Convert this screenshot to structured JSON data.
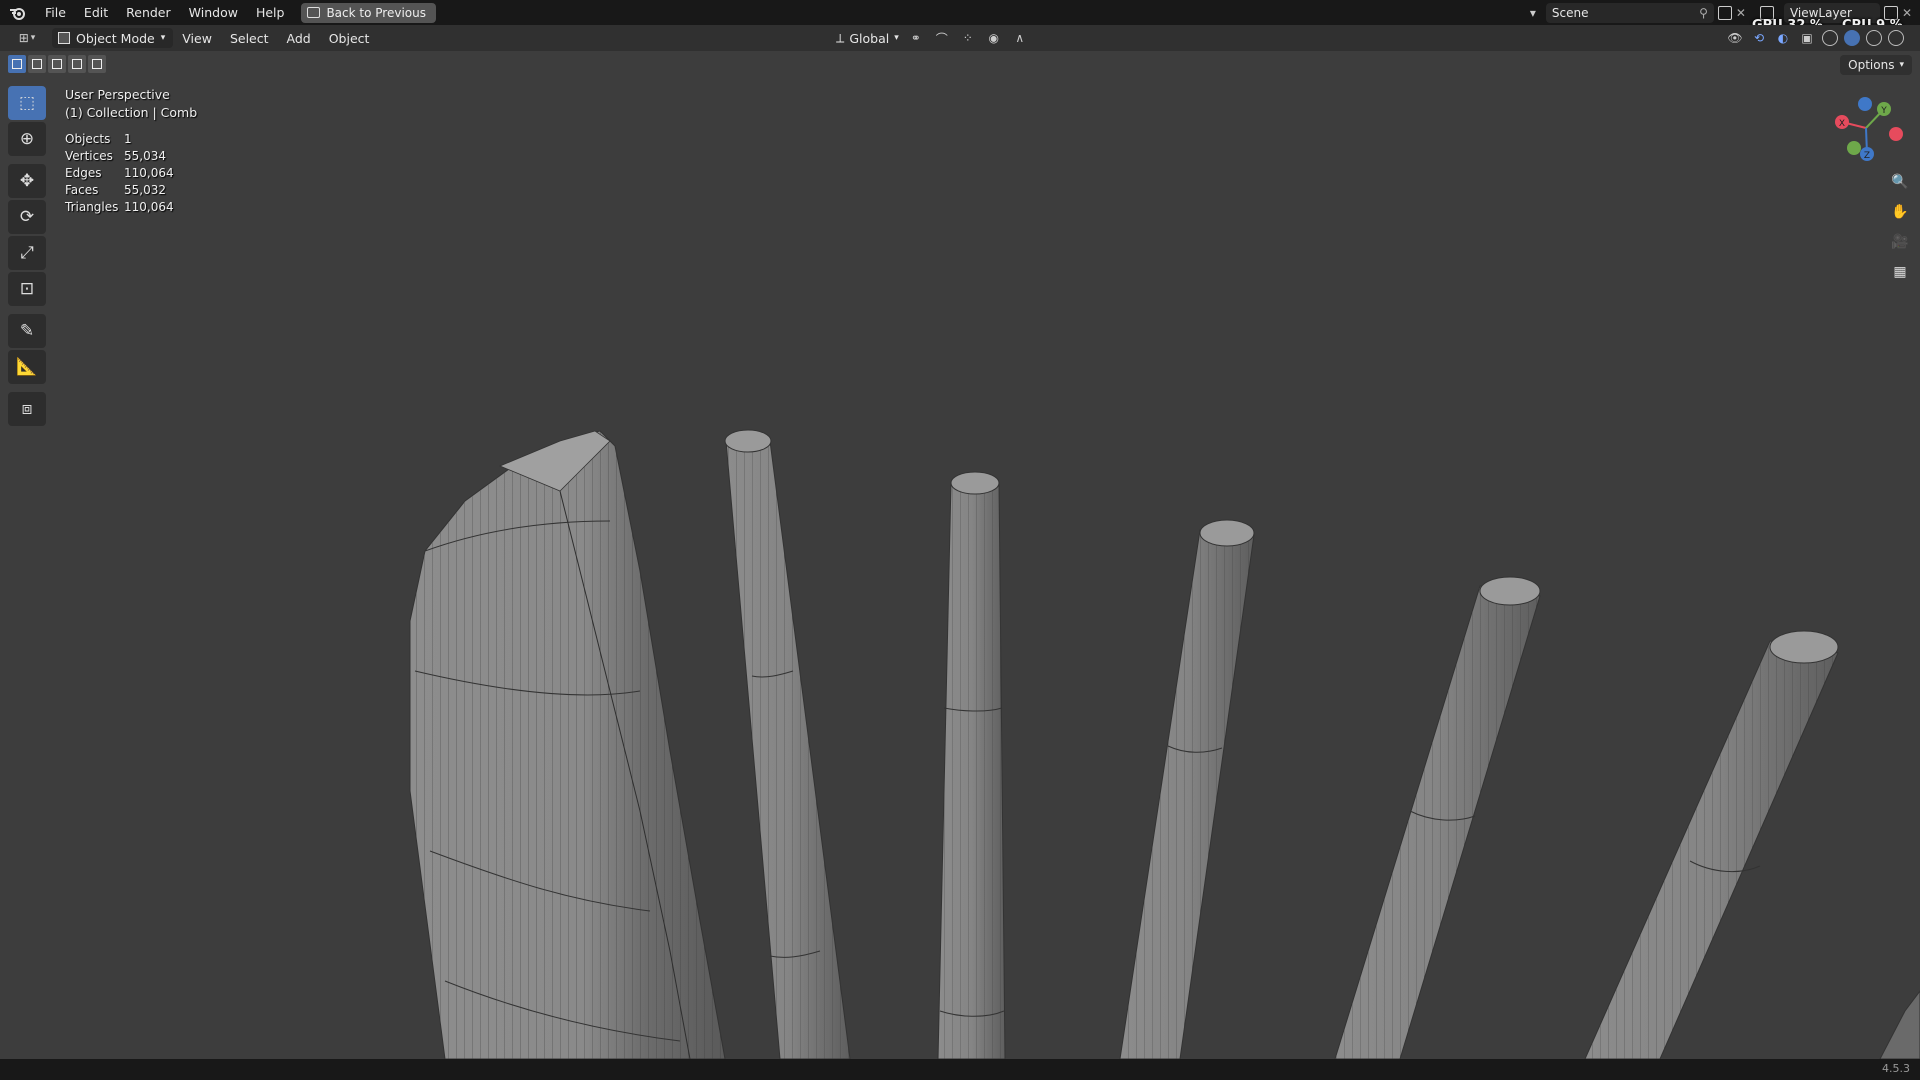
{
  "topbar": {
    "logo_icon": "blender-logo-icon",
    "menu": [
      "File",
      "Edit",
      "Render",
      "Window",
      "Help"
    ],
    "back_label": "Back to Previous",
    "scene": "Scene",
    "view_layer": "ViewLayer",
    "gpu_label": "GPU",
    "gpu_value": "32 %",
    "cpu_label": "CPU",
    "cpu_value": "9 %"
  },
  "header": {
    "mode": "Object Mode",
    "menu": [
      "View",
      "Select",
      "Add",
      "Object"
    ],
    "orientation": "Global",
    "options_label": "Options"
  },
  "viewport": {
    "view_name": "User Perspective",
    "collection": "(1) Collection | Comb",
    "stats": [
      {
        "key": "Objects",
        "value": "1"
      },
      {
        "key": "Vertices",
        "value": "55,034"
      },
      {
        "key": "Edges",
        "value": "110,064"
      },
      {
        "key": "Faces",
        "value": "55,032"
      },
      {
        "key": "Triangles",
        "value": "110,064"
      }
    ],
    "gizmo": {
      "x": "X",
      "y": "Y",
      "z": "Z",
      "x_color": "#e64b5d",
      "y_color": "#6ea84a",
      "z_color": "#3f78c8"
    }
  },
  "status": {
    "version": "4.5.3"
  },
  "colors": {
    "accent": "#4772b3",
    "bg_viewport": "#3d3d3d",
    "mesh": "#8a8a8a",
    "wire": "#2a2a2a"
  }
}
